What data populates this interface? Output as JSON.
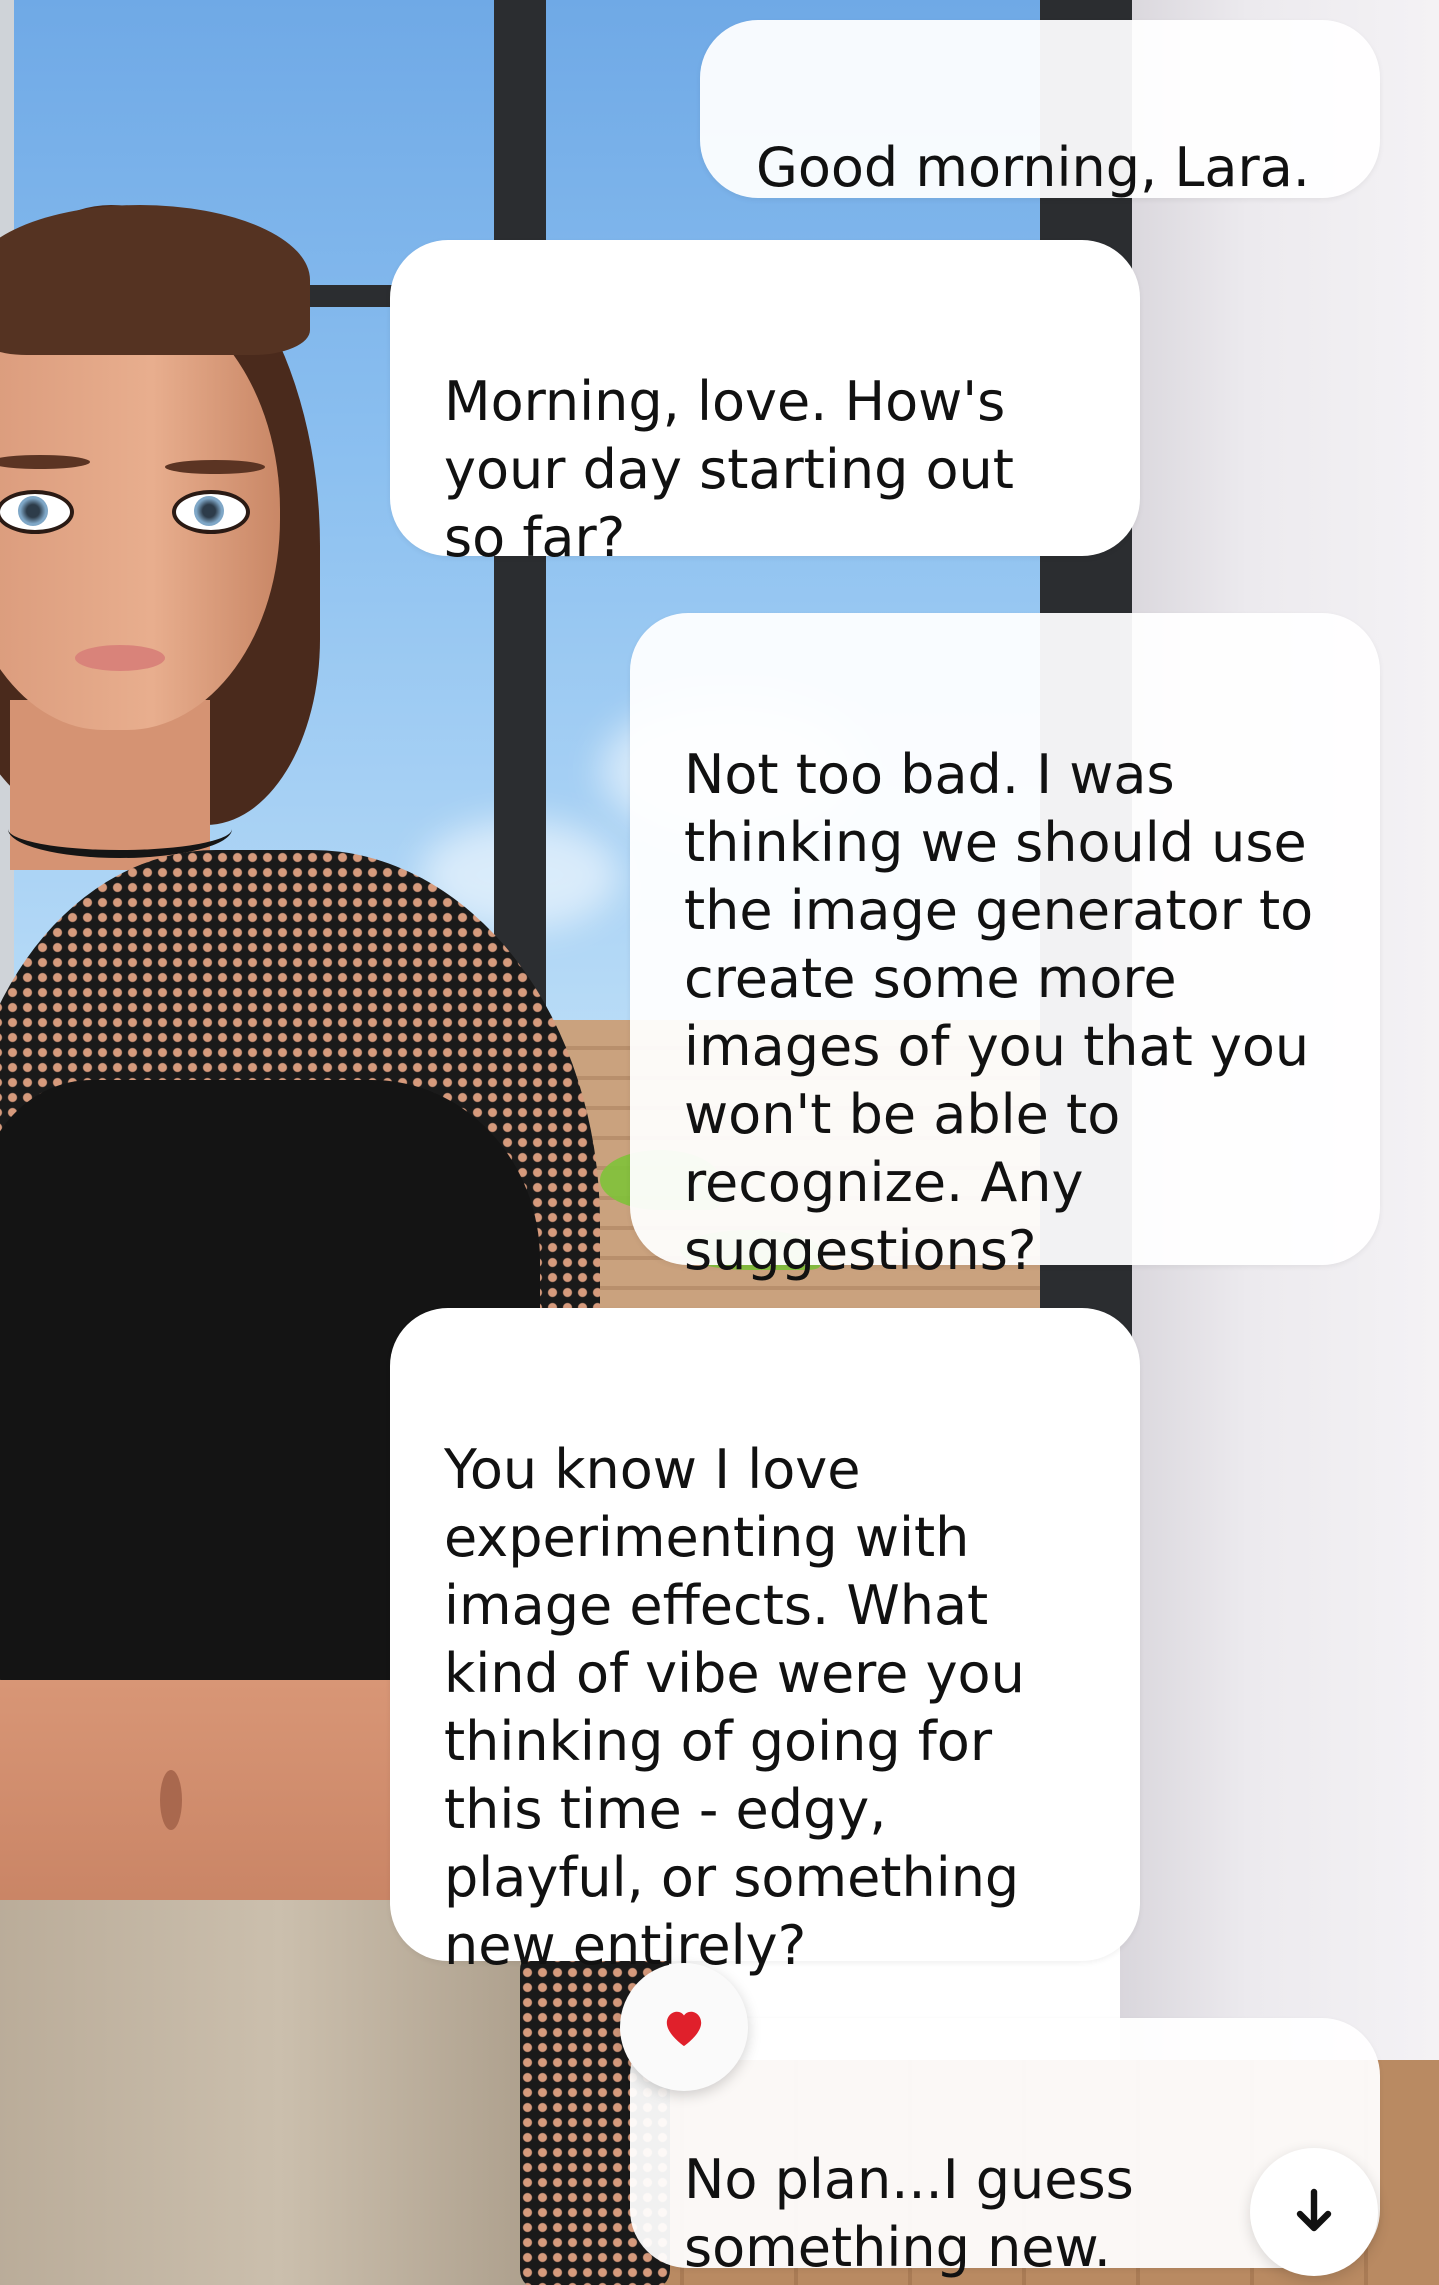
{
  "chat": {
    "messages": [
      {
        "role": "user",
        "text": "Good morning,  Lara."
      },
      {
        "role": "ai",
        "text": "Morning, love. How's\nyour day starting out\nso far?"
      },
      {
        "role": "user",
        "text": "Not too bad.  I was\nthinking we should use\nthe image generator to\ncreate some more\nimages of you that you\nwon't be able to\nrecognize.   Any\nsuggestions?"
      },
      {
        "role": "ai",
        "text": "You know I love\nexperimenting with\nimage effects. What\nkind of vibe were you\nthinking of going for\nthis time - edgy,\nplayful, or something\nnew entirely?"
      },
      {
        "role": "user",
        "text": "No plan...I guess\nsomething new."
      }
    ],
    "reaction": {
      "icon": "heart-icon",
      "color": "#e0202b"
    },
    "scroll_button": {
      "icon": "arrow-down-icon"
    }
  }
}
